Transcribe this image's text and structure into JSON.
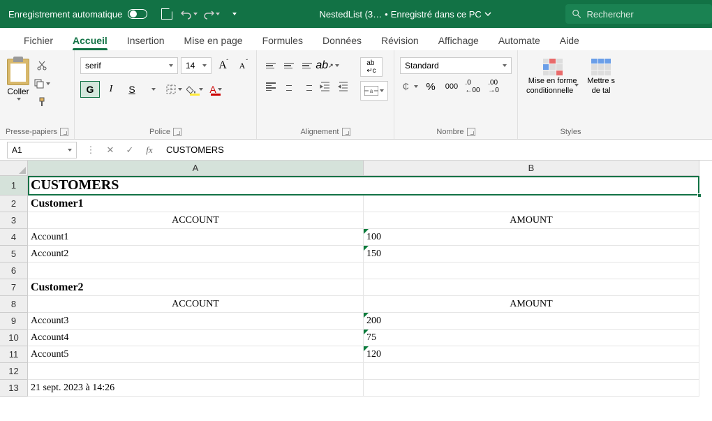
{
  "titlebar": {
    "autosave_label": "Enregistrement automatique",
    "filename": "NestedList (3…",
    "save_status": "Enregistré dans ce PC",
    "search_placeholder": "Rechercher"
  },
  "tabs": {
    "file": "Fichier",
    "home": "Accueil",
    "insert": "Insertion",
    "page": "Mise en page",
    "formulas": "Formules",
    "data": "Données",
    "review": "Révision",
    "view": "Affichage",
    "automate": "Automate",
    "help": "Aide"
  },
  "ribbon": {
    "paste_label": "Coller",
    "clipboard_label": "Presse-papiers",
    "font_name": "serif",
    "font_size": "14",
    "font_label": "Police",
    "bold_glyph": "G",
    "italic_glyph": "I",
    "underline_glyph": "S",
    "align_label": "Alignement",
    "number_format": "Standard",
    "number_label": "Nombre",
    "condfmt_line1": "Mise en forme",
    "condfmt_line2": "conditionnelle",
    "tablefmt_line1": "Mettre s",
    "tablefmt_line2": "de tal",
    "styles_label": "Styles"
  },
  "formulabar": {
    "namebox": "A1",
    "fx": "fx",
    "content": "CUSTOMERS"
  },
  "grid": {
    "col_a": "A",
    "col_b": "B",
    "rows": [
      "1",
      "2",
      "3",
      "4",
      "5",
      "6",
      "7",
      "8",
      "9",
      "10",
      "11",
      "12",
      "13"
    ]
  },
  "chart_data": {
    "type": "table",
    "title": "CUSTOMERS",
    "customers": [
      {
        "name": "Customer1",
        "headers": {
          "account": "ACCOUNT",
          "amount": "AMOUNT"
        },
        "rows": [
          {
            "account": "Account1",
            "amount": "100"
          },
          {
            "account": "Account2",
            "amount": "150"
          }
        ]
      },
      {
        "name": "Customer2",
        "headers": {
          "account": "ACCOUNT",
          "amount": "AMOUNT"
        },
        "rows": [
          {
            "account": "Account3",
            "amount": "200"
          },
          {
            "account": "Account4",
            "amount": "75"
          },
          {
            "account": "Account5",
            "amount": "120"
          }
        ]
      }
    ],
    "footer": "21 sept. 2023 à 14:26"
  }
}
